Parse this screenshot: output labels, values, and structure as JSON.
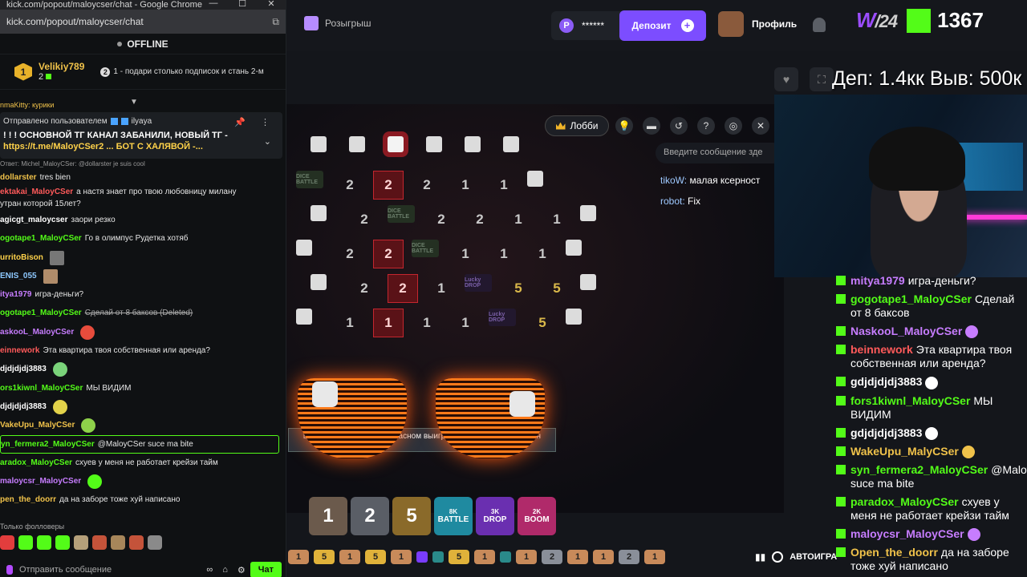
{
  "window": {
    "title": "kick.com/popout/maloycser/chat - Google Chrome",
    "url": "kick.com/popout/maloycser/chat"
  },
  "chat_popout": {
    "status": "OFFLINE",
    "top_gifter": {
      "name": "Velikiy789",
      "count": "2",
      "rank": "1"
    },
    "gift_note": {
      "badge": "2",
      "text": "1 - подари столько подписок и стань 2-м"
    },
    "scrolled_line": "nmaKitty: курики",
    "pinned": {
      "by": "Отправлено пользователем",
      "user": "ilyaya",
      "line1": "! ! ! ОСНОВНОЙ ТГ КАНАЛ ЗАБАНИЛИ, НОВЫЙ ТГ -",
      "line2": "https://t.me/MaloyCSer2 ... БОТ С ХАЛЯВОЙ -..."
    },
    "reply_hint": "Ответ: Michel_MaloyCSer: @dollarster je suis cool",
    "messages": [
      {
        "user": "dollarster",
        "text": "tres bien",
        "color": "#f0c24a"
      },
      {
        "user": "ektakai_MaloyCSer",
        "text": "а настя знает про твою любовницу милану",
        "color": "#ff5a5a"
      },
      {
        "user": "",
        "text": "утран которой 15лет?",
        "color": "#ffffff"
      },
      {
        "user": "agicgt_maloycser",
        "text": "зaори резко",
        "color": "#ffffff"
      },
      {
        "user": "ogotape1_MaloyCSer",
        "text": "Го в олимпус Рудетка хотяб",
        "color": "#53fc18"
      },
      {
        "user": "urritoBison",
        "text": "",
        "color": "#ffd24a"
      },
      {
        "user": "ENIS_055",
        "text": "",
        "color": "#8ec9ff"
      },
      {
        "user": "itya1979",
        "text": "игра-деньги?",
        "color": "#c77dff"
      },
      {
        "user": "ogotape1_MaloyCSer",
        "text": "Сделай от 8 баксов (Deleted)",
        "color": "#53fc18"
      },
      {
        "user": "askooL_MaloyCSer",
        "text": "",
        "color": "#c77dff"
      },
      {
        "user": "einnework",
        "text": "Эта квартира твоя собственная или аренда?",
        "color": "#ff5a5a"
      },
      {
        "user": "djdjdjdj3883",
        "text": "",
        "color": "#ffffff"
      },
      {
        "user": "ors1kiwnl_MaloyCSer",
        "text": "МЫ ВИДИМ",
        "color": "#53fc18"
      },
      {
        "user": "djdjdjdj3883",
        "text": "",
        "color": "#ffffff"
      },
      {
        "user": "VakeUpu_MalyCSer",
        "text": "",
        "color": "#f0c24a"
      },
      {
        "user": "yn_fermera2_MaloyCSer",
        "text": "@MaloyCSer suce ma bite",
        "color": "#53fc18"
      },
      {
        "user": "aradox_MaloyCSer",
        "text": "схуев у меня не работает крейзи тайм",
        "color": "#53fc18"
      },
      {
        "user": "maloycsr_MaloyCSer",
        "text": "",
        "color": "#c77dff"
      },
      {
        "user": "pen_the_doorr",
        "text": "да на заборе тоже хуй написано",
        "color": "#f0c24a"
      }
    ],
    "followers_only": "Только фолловеры",
    "send_placeholder": "Отправить сообщение",
    "chat_button": "Чат"
  },
  "casino": {
    "giveaway": "Розыгрыш",
    "balance": "******",
    "deposit": "Депозит",
    "profile": "Профиль",
    "lobby": "Лобби",
    "subtitle": "шесть на синем три на красном выигрышный результат — один",
    "autoplay": "АВТОИГРА",
    "grid_rows": [
      [
        "die",
        "die",
        "die-red",
        "die",
        "die",
        "die",
        ""
      ],
      [
        "logo",
        "2",
        "2",
        "2",
        "1",
        "1",
        "die"
      ],
      [
        "die",
        "2",
        "logo",
        "2",
        "2",
        "1",
        "1",
        "die"
      ],
      [
        "die",
        "2",
        "2",
        "logo",
        "1",
        "1",
        "1",
        "die"
      ],
      [
        "die",
        "2",
        "2",
        "1",
        "drop",
        "5",
        "5",
        "die"
      ],
      [
        "die",
        "1",
        "1",
        "1",
        "1",
        "drop",
        "5",
        "die"
      ]
    ],
    "chips": [
      {
        "label": "1",
        "sub": "",
        "color": "#6b5a4c"
      },
      {
        "label": "2",
        "sub": "",
        "color": "#5a5e66"
      },
      {
        "label": "5",
        "sub": "",
        "color": "#8a6a2a"
      },
      {
        "label": "BATTLE",
        "sub": "8K",
        "color": "#1f8aa0"
      },
      {
        "label": "DROP",
        "sub": "3K",
        "color": "#6a2fb0"
      },
      {
        "label": "BOOM",
        "sub": "2K",
        "color": "#b02a6a"
      }
    ],
    "history": [
      "1",
      "5",
      "1",
      "5",
      "1",
      "",
      "",
      "5",
      "1",
      "",
      "1",
      "2",
      "1",
      "1",
      "2",
      "1"
    ],
    "history_colors": [
      "#c88a5a",
      "#e0b23a",
      "#c88a5a",
      "#e0b23a",
      "#c88a5a",
      "#7a3cff",
      "#2a8a8a",
      "#e0b23a",
      "#c88a5a",
      "#2a8a8a",
      "#c88a5a",
      "#8a8f99",
      "#c88a5a",
      "#c88a5a",
      "#8a8f99",
      "#c88a5a"
    ]
  },
  "stream_overlay": {
    "w24": "W",
    "w24_num": "/24",
    "k_count": "1367",
    "dep_vyv": "Деп: 1.4кк Выв: 500к",
    "input_placeholder": "Введите сообщение зде",
    "live_lines": [
      {
        "user": "tikoW:",
        "text": "малая ксерност"
      },
      {
        "user": "robot:",
        "text": "Fix"
      }
    ],
    "chat": [
      {
        "user": "mitya1979",
        "text": "игра-деньги?",
        "color": "#c77dff"
      },
      {
        "user": "gogotape1_MaloyCSer",
        "text": "Сделай от 8 баксов",
        "color": "#53fc18"
      },
      {
        "user": "NaskooL_MaloyCSer",
        "text": "",
        "color": "#c77dff"
      },
      {
        "user": "beinnework",
        "text": "Эта квартира твоя собственная или аренда?",
        "color": "#ff5a5a"
      },
      {
        "user": "gdjdjdjdj3883",
        "text": "",
        "color": "#ffffff"
      },
      {
        "user": "fors1kiwnl_MaloyCSer",
        "text": "МЫ ВИДИМ",
        "color": "#53fc18"
      },
      {
        "user": "gdjdjdjdj3883",
        "text": "",
        "color": "#ffffff"
      },
      {
        "user": "WakeUpu_MalyCSer",
        "text": "",
        "color": "#f0c24a"
      },
      {
        "user": "syn_fermera2_MaloyCSer",
        "text": "@MaloyCSer suce ma bite",
        "color": "#53fc18"
      },
      {
        "user": "paradox_MaloyCSer",
        "text": "схуев у меня не работает крейзи тайм",
        "color": "#53fc18"
      },
      {
        "user": "maloycsr_MaloyCSer",
        "text": "",
        "color": "#c77dff"
      },
      {
        "user": "Open_the_doorr",
        "text": "да на заборе тоже хуй написано",
        "color": "#f0c24a"
      }
    ]
  }
}
